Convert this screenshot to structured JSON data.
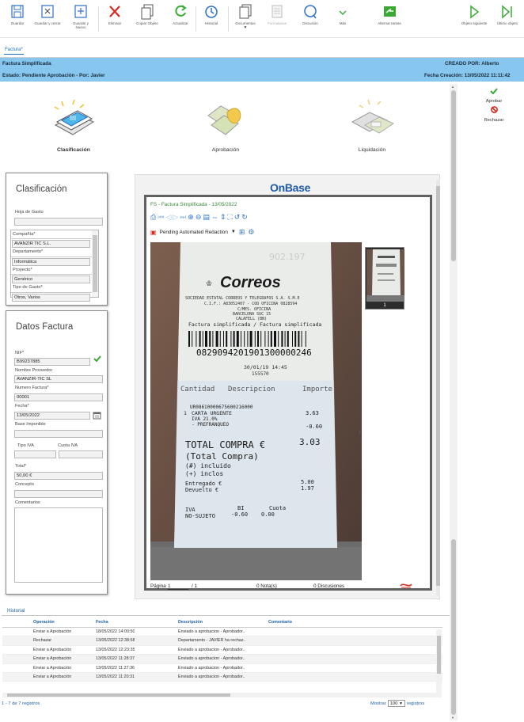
{
  "toolbar": {
    "guardar": "Guardar",
    "guardar_cerrar": "Guardar y cerrar",
    "guardar_nuevo": "Guardar y\nNuevo",
    "eliminar": "Eliminar",
    "copiar_objeto": "Copiar Objeto",
    "actualizar": "Actualizar",
    "historial": "Historial",
    "documentos": "Documentos",
    "formularios": "Formularios",
    "discusion": "Discusión",
    "mas": "Más",
    "alternar_tareas": "Alternar tareas",
    "objeto_siguiente": "Objeto siguiente",
    "ultimo_objeto": "Último objeto"
  },
  "tab": {
    "label": "Factura*"
  },
  "header": {
    "title": "Factura Simplificada",
    "status": "Estado: Pendiente Aprobación - Por: Javier",
    "created_by": "CREADO POR: Alberto",
    "created_date": "Fecha Creación: 13/05/2022 11:11:42"
  },
  "actions": {
    "approve": "Aprobar",
    "reject": "Rechazar"
  },
  "stages": [
    "Clasificación",
    "Aprobación",
    "Liquidación"
  ],
  "clasificacion": {
    "title": "Clasificación",
    "hoja_gasto_label": "Hoja de Gasto",
    "hoja_gasto_value": "",
    "list": [
      {
        "label": "Compañía*",
        "value": "AVANZIR TIC S.L."
      },
      {
        "label": "Departamento*",
        "value": "Informática"
      },
      {
        "label": "Proyecto*",
        "value": "Genérico"
      },
      {
        "label": "Tipo de Gasto*",
        "value": "Otros, Varios"
      }
    ]
  },
  "datos": {
    "title": "Datos Factura",
    "nif_label": "NIF*",
    "nif_value": "B99237885",
    "proveedor_label": "Nombre Proveedor",
    "proveedor_value": "AVANZIR-TIC SL",
    "numero_label": "Numero Factura*",
    "numero_value": "00001",
    "fecha_label": "Fecha*",
    "fecha_value": "13/05/2022",
    "base_label": "Base Imponible",
    "base_value": "",
    "tipo_iva_label": "Tipo IVA",
    "cuota_iva_label": "Cuota IVA",
    "total_label": "Total*",
    "total_value": "50,00 €",
    "concepto_label": "Concepto",
    "concepto_value": "",
    "comentarios_label": "Comentarios"
  },
  "viewer": {
    "brand": "OnBase",
    "doc_title": "FS - Factura Simplificada - 13/05/2022",
    "redaction": "Pending Automated Redaction",
    "page_label": "Página",
    "page_value": "1",
    "page_total": "/ 1",
    "notes": "0 Nota(s)",
    "discussions": "0 Discusiones",
    "thumb_num": "1",
    "receipt": {
      "brand": "Correos",
      "company": "SOCIEDAD ESTATAL CORREOS Y TELEGRAFOS S.A. S.M.E",
      "cif": "C.I.F.: A83052407 - COD OFICINA 0828594",
      "line3": "C/MES. OFICINA",
      "city": "BARCELONA SUC 15",
      "sub": "CALAFELL (BN)",
      "doc": "Factura simplificada / Factura simplificada",
      "barcode": "0829094201901300000246",
      "date": "30/01/19 14:45",
      "ref": "155570",
      "col1": "Cantidad",
      "col2": "Descripcion",
      "col3": "Importe",
      "code": "UR08610000675600216000",
      "qty": "1",
      "item": "CARTA URGENTE",
      "item_price": "3.63",
      "iva": "IVA 21.0%",
      "prefranq": "- PREFRANQUEO",
      "prefranq_price": "-0.60",
      "total_label": "TOTAL COMPRA €",
      "total_value": "3.03",
      "total_sub": "(Total Compra)",
      "incl1": "(#) incluido",
      "incl2": "(+) inclos",
      "entregado": "Entregado €",
      "entregado_v": "5.00",
      "devuelto": "Devuelto €",
      "devuelto_v": "1.97",
      "iva_h": "IVA",
      "bi_h": "BI",
      "cuota_h": "Cuota",
      "ns": "NO-SUJETO",
      "ns_bi": "-0.60",
      "ns_cuota": "0.00",
      "watermark": "902.197"
    }
  },
  "historial": {
    "title": "Historial",
    "columns": [
      "Operación",
      "Fecha",
      "Descripción",
      "Comentario"
    ],
    "rows": [
      [
        "Enviar a Aprobación",
        "18/05/2022 14:00:50",
        "Enviado a aprobacion - Aprobador..",
        ""
      ],
      [
        "Rechazar",
        "13/05/2022 12:38:58",
        "Departamento - JAVIER ha rechaz..",
        ""
      ],
      [
        "Enviar a Aprobación",
        "13/05/2022 12:23:35",
        "Enviado a aprobacion - Aprobador..",
        ""
      ],
      [
        "Enviar a Aprobación",
        "13/05/2022 11:28:37",
        "Enviado a aprobacion - Aprobador..",
        ""
      ],
      [
        "Enviar a Aprobación",
        "13/05/2022 11:27:36",
        "Enviado a aprobacion - Aprobador..",
        ""
      ],
      [
        "Enviar a Aprobación",
        "13/05/2022 11:20:31",
        "Enviado a aprobacion - Aprobador..",
        ""
      ]
    ],
    "footer": "1 - 7 de 7 registros",
    "show_label": "Mostrar",
    "show_value": "100",
    "show_suffix": "registros"
  },
  "colors": {
    "header": "#86c6ef",
    "accent": "#1c5fa8",
    "approve": "#3aaa35",
    "reject": "#d9281c"
  }
}
